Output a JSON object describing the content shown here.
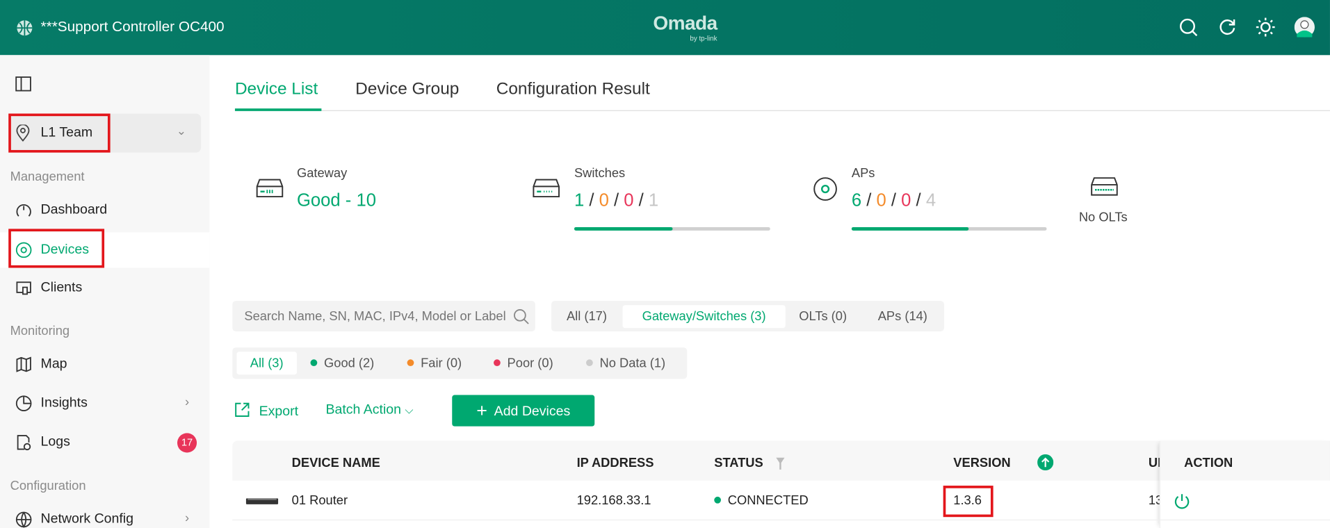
{
  "header": {
    "title": "***Support Controller OC400",
    "logo": "Omada",
    "logo_sub": "by tp-link",
    "icons": [
      "search-icon",
      "refresh-icon",
      "theme-sun-icon",
      "user-avatar"
    ]
  },
  "sidebar": {
    "site": "L1 Team",
    "sections": {
      "management": "Management",
      "monitoring": "Monitoring",
      "configuration": "Configuration"
    },
    "items": [
      {
        "label": "Dashboard",
        "icon": "dashboard-icon"
      },
      {
        "label": "Devices",
        "icon": "devices-icon",
        "active": true
      },
      {
        "label": "Clients",
        "icon": "clients-icon"
      },
      {
        "label": "Map",
        "icon": "map-icon"
      },
      {
        "label": "Insights",
        "icon": "insights-icon"
      },
      {
        "label": "Logs",
        "icon": "logs-icon",
        "badge": "17"
      },
      {
        "label": "Network Config",
        "icon": "globe-icon"
      }
    ]
  },
  "tabs": [
    {
      "label": "Device List",
      "active": true
    },
    {
      "label": "Device Group"
    },
    {
      "label": "Configuration Result"
    }
  ],
  "summary": {
    "gateway": {
      "label": "Gateway",
      "value": "Good - 10"
    },
    "switches": {
      "label": "Switches",
      "good": "1",
      "fair": "0",
      "poor": "0",
      "nodata": "1",
      "sep": "/",
      "good_fraction": 0.5
    },
    "aps": {
      "label": "APs",
      "good": "6",
      "fair": "0",
      "poor": "0",
      "nodata": "4",
      "good_fraction": 0.6
    },
    "olts": {
      "label": "No OLTs"
    }
  },
  "search": {
    "placeholder": "Search Name, SN, MAC, IPv4, Model or Label"
  },
  "type_filter": [
    "All (17)",
    "Gateway/Switches (3)",
    "OLTs (0)",
    "APs (14)"
  ],
  "status_filter": [
    "All (3)",
    "Good (2)",
    "Fair (0)",
    "Poor (0)",
    "No Data (1)"
  ],
  "actions": {
    "export": "Export",
    "batch": "Batch Action",
    "add": "Add Devices"
  },
  "table": {
    "headers": [
      "DEVICE NAME",
      "IP ADDRESS",
      "STATUS",
      "VERSION",
      "UPTIME",
      "ACTION"
    ],
    "header_truncated": "U",
    "rows": [
      {
        "name": "01 Router",
        "ip": "192.168.33.1",
        "status": "CONNECTED",
        "version": "1.3.6",
        "uptime": "13"
      }
    ]
  },
  "colors": {
    "brand": "#067b67",
    "accent": "#00a870",
    "fair": "#f48b2a",
    "poor": "#e8355a",
    "highlight": "#e3161b"
  }
}
